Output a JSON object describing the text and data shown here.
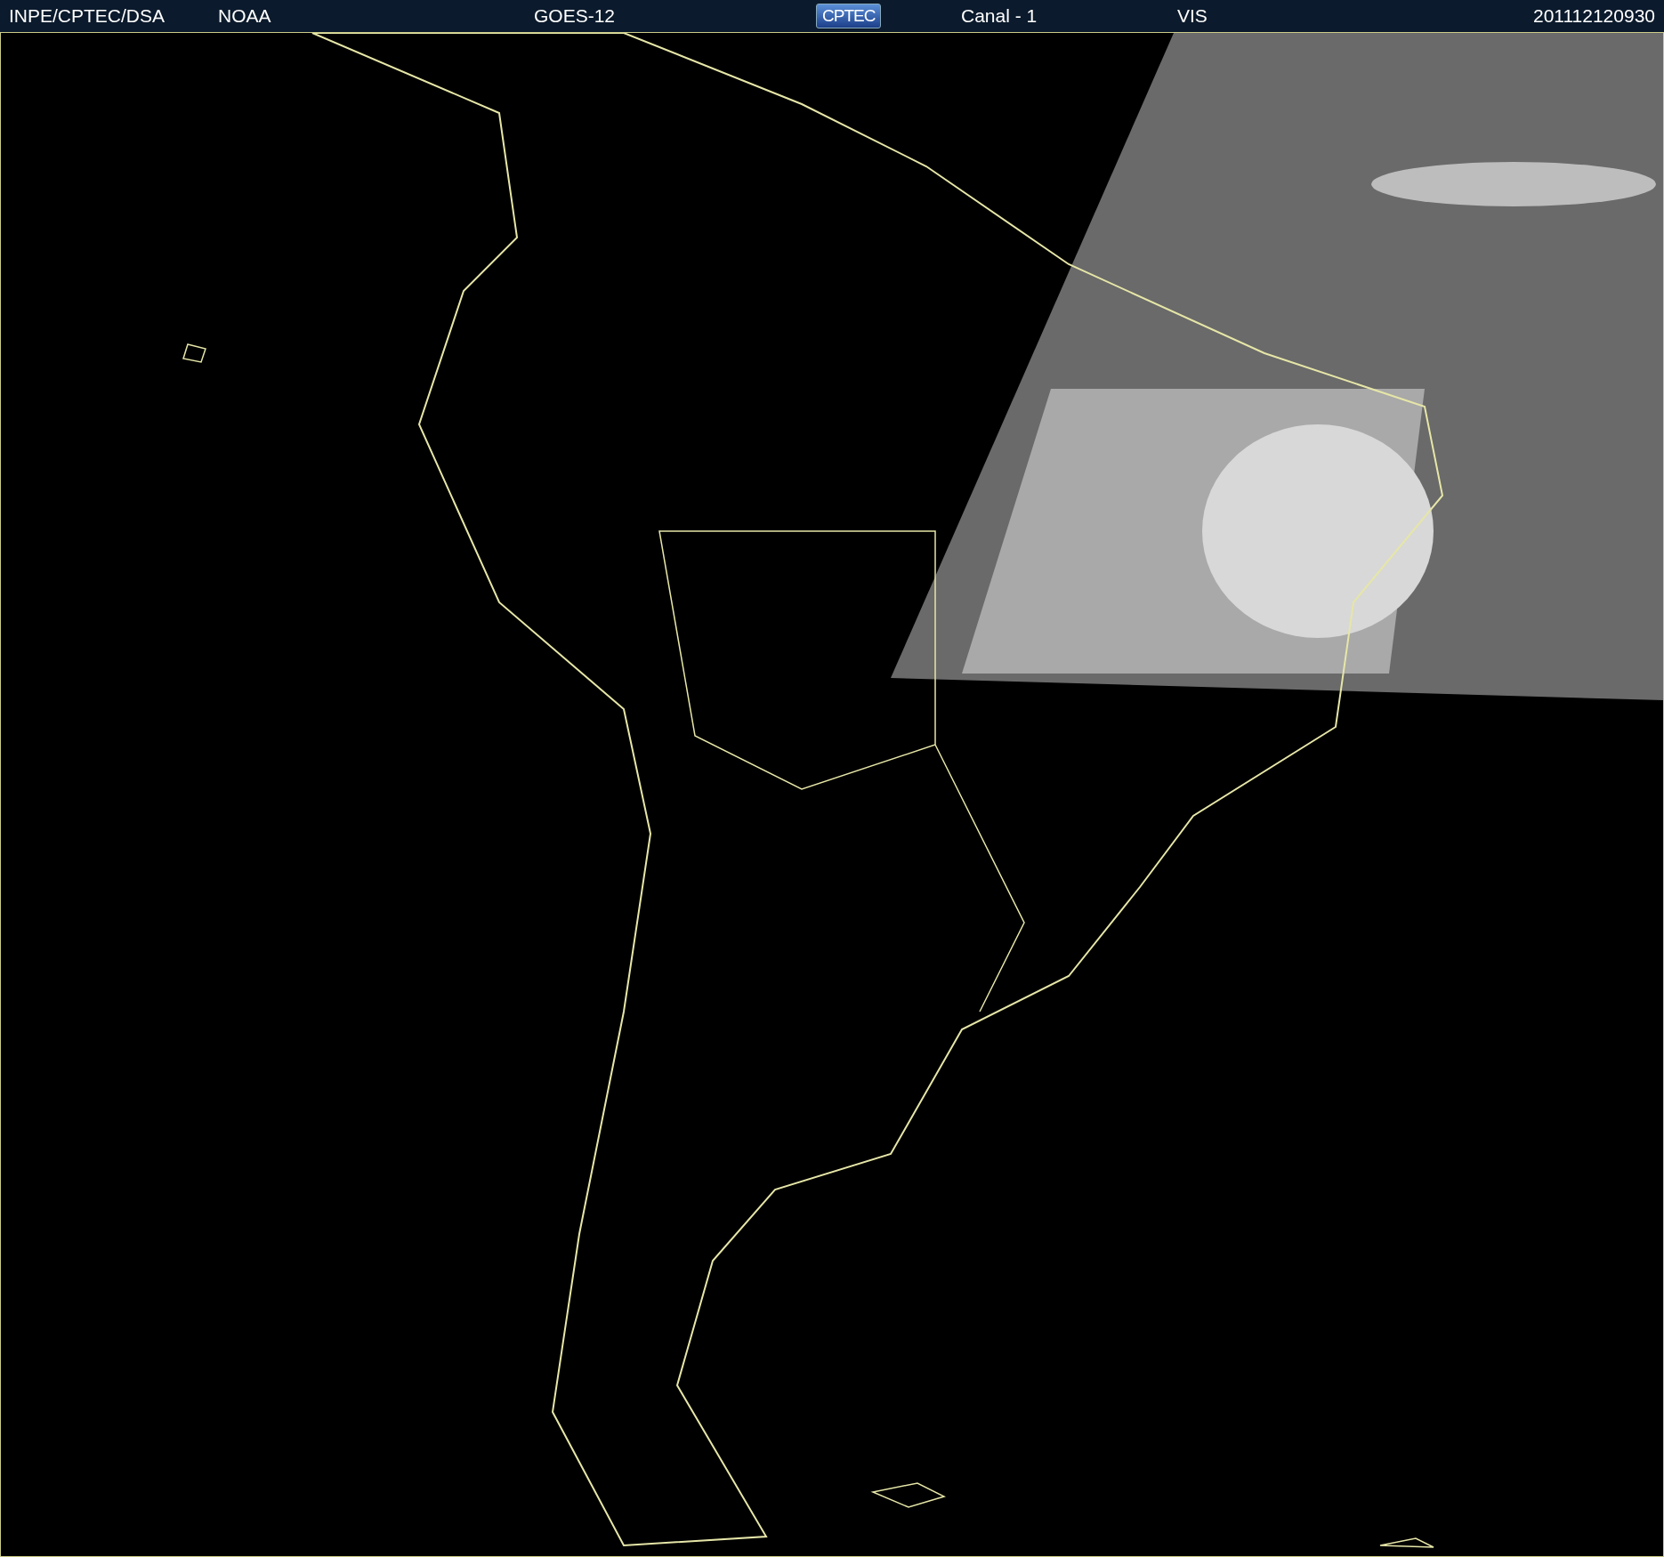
{
  "header": {
    "source": "INPE/CPTEC/DSA",
    "agency": "NOAA",
    "satellite": "GOES-12",
    "logo": "CPTEC",
    "channel": "Canal - 1",
    "band": "VIS",
    "timestamp": "201112120930"
  }
}
